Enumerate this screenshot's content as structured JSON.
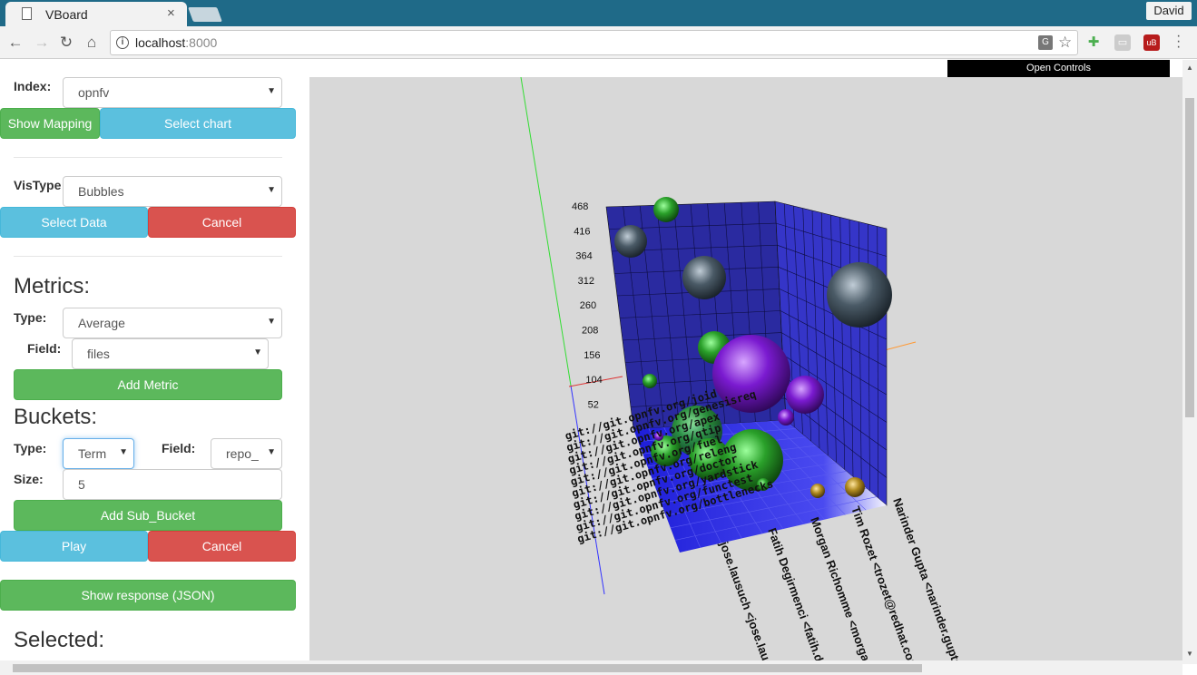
{
  "browser": {
    "tab_title": "VBoard",
    "tab_close": "×",
    "profile_name": "David",
    "url_host": "localhost",
    "url_port": ":8000",
    "nav": {
      "back": "←",
      "forward": "→",
      "reload": "↻",
      "home": "⌂"
    },
    "icons": [
      "page-icon",
      "info-icon",
      "translate-icon",
      "star-icon",
      "extension-icon",
      "cast-icon",
      "ublock-icon",
      "menu-icon"
    ]
  },
  "panel": {
    "index_label": "Index:",
    "index_value": "opnfv",
    "show_mapping": "Show Mapping",
    "select_chart": "Select chart",
    "vistype_label": "VisType",
    "vistype_value": "Bubbles",
    "select_data": "Select Data",
    "cancel": "Cancel",
    "metrics_heading": "Metrics:",
    "metric_type_label": "Type:",
    "metric_type_value": "Average",
    "metric_field_label": "Field:",
    "metric_field_value": "files",
    "add_metric": "Add Metric",
    "buckets_heading": "Buckets:",
    "bucket_type_label": "Type:",
    "bucket_type_value": "Term",
    "bucket_field_label": "Field:",
    "bucket_field_value": "repo_",
    "size_label": "Size:",
    "size_value": "5",
    "add_sub_bucket": "Add Sub_Bucket",
    "play": "Play",
    "cancel2": "Cancel",
    "show_response": "Show response (JSON)",
    "selected_heading": "Selected:"
  },
  "viz": {
    "open_controls": "Open Controls",
    "y_ticks": [
      "468",
      "416",
      "364",
      "312",
      "260",
      "208",
      "156",
      "104",
      "52"
    ],
    "repo_labels": [
      "git://git.opnfv.org/joid",
      "git://git.opnfv.org/genesisreq",
      "git://git.opnfv.org/apex",
      "git://git.opnfv.org/qtip",
      "git://git.opnfv.org/fuel",
      "git://git.opnfv.org/releng",
      "git://git.opnfv.org/doctor",
      "git://git.opnfv.org/yardstick",
      "git://git.opnfv.org/functest",
      "git://git.opnfv.org/bottlenecks"
    ],
    "author_labels": [
      "jose.lausuch <jose.lausu",
      "Fatih Degirmenci <fatih.de",
      "Morgan Richomme <morgan",
      "Tim Rozet <trozet@redhat.com",
      "Narinder Gupta <narinder.gupta@"
    ],
    "colors": {
      "wall": "#2a2aa0",
      "floor": "#3838e0",
      "bg": "#d8d8d8",
      "green": "#2aa02a",
      "purple": "#7a1ad0",
      "gray": "#4a5a66",
      "gold": "#b08a20"
    }
  }
}
